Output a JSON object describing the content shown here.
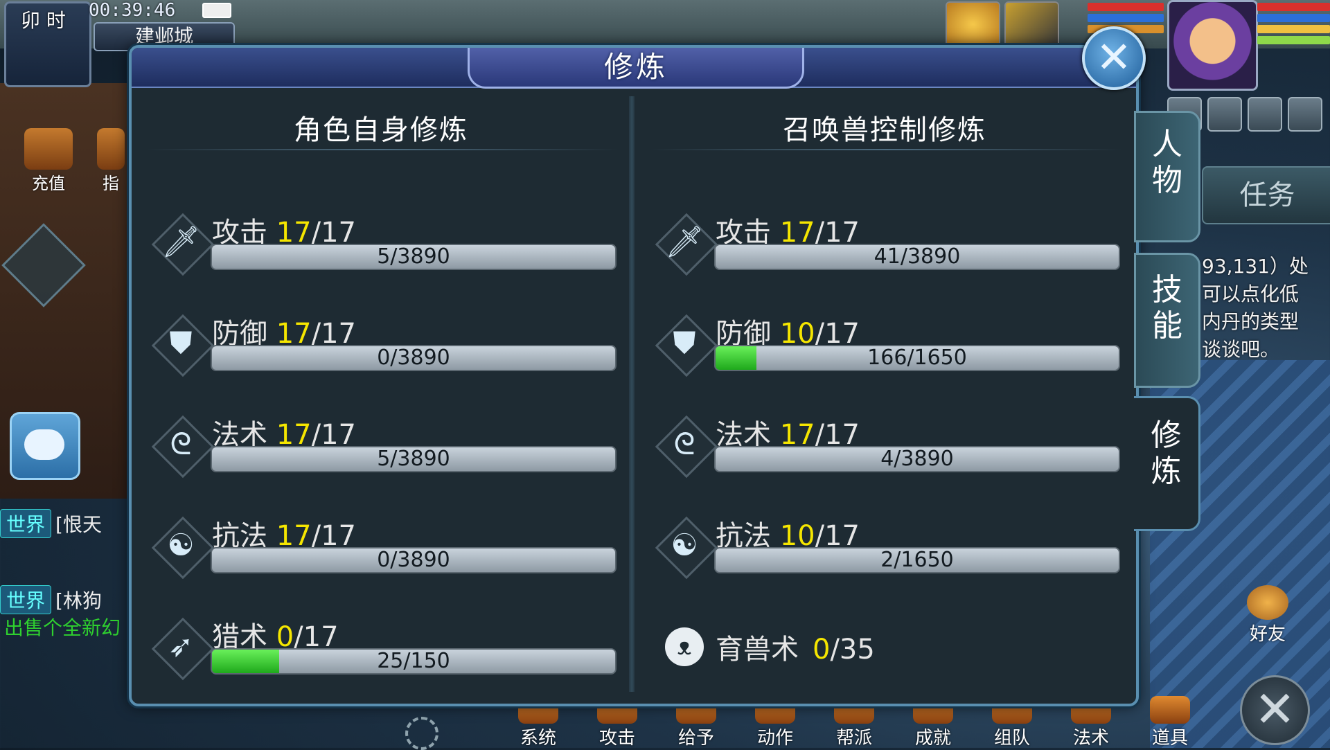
{
  "hud": {
    "shichen": "卯 时",
    "time": "00:39:46",
    "city": "建邺城",
    "recharge_label": "充值",
    "guide_label": "指",
    "chat_messages": [
      {
        "channel": "世界",
        "text": "[恨天",
        "sub": ""
      },
      {
        "channel": "世界",
        "text": "[林狗",
        "sub": "出售个全新幻"
      }
    ]
  },
  "right_hud": {
    "task_tab": "任务",
    "task_text": [
      "93,131）处",
      "可以点化低",
      "内丹的类型",
      "谈谈吧。"
    ],
    "friend_label": "好友",
    "close_icon_label": "✕"
  },
  "bottom_bar": [
    "系统",
    "攻击",
    "给予",
    "动作",
    "帮派",
    "成就",
    "组队",
    "法术",
    "道具"
  ],
  "dialog": {
    "title": "修炼",
    "close": "✕",
    "left_title": "角色自身修炼",
    "right_title": "召唤兽控制修炼",
    "left_rows": [
      {
        "name": "攻击",
        "level": "17",
        "max": "/17",
        "progress": "5/3890",
        "fraction": 0.0013,
        "icon": "sword-icon",
        "glyph": "🗡"
      },
      {
        "name": "防御",
        "level": "17",
        "max": "/17",
        "progress": "0/3890",
        "fraction": 0.0,
        "icon": "shield-icon",
        "glyph": "⛊"
      },
      {
        "name": "法术",
        "level": "17",
        "max": "/17",
        "progress": "5/3890",
        "fraction": 0.0013,
        "icon": "staff-icon",
        "glyph": "ᘓ"
      },
      {
        "name": "抗法",
        "level": "17",
        "max": "/17",
        "progress": "0/3890",
        "fraction": 0.0,
        "icon": "yinyang-icon",
        "glyph": "☯"
      },
      {
        "name": "猎术",
        "level": "0",
        "max": "/17",
        "progress": "25/150",
        "fraction": 0.1667,
        "icon": "bow-icon",
        "glyph": "➶"
      }
    ],
    "right_rows": [
      {
        "name": "攻击",
        "level": "17",
        "max": "/17",
        "progress": "41/3890",
        "fraction": 0.0105,
        "icon": "sword-icon",
        "glyph": "🗡"
      },
      {
        "name": "防御",
        "level": "10",
        "max": "/17",
        "progress": "166/1650",
        "fraction": 0.1006,
        "icon": "shield-icon",
        "glyph": "⛊"
      },
      {
        "name": "法术",
        "level": "17",
        "max": "/17",
        "progress": "4/3890",
        "fraction": 0.001,
        "icon": "staff-icon",
        "glyph": "ᘓ"
      },
      {
        "name": "抗法",
        "level": "10",
        "max": "/17",
        "progress": "2/1650",
        "fraction": 0.0012,
        "icon": "yinyang-icon",
        "glyph": "☯"
      }
    ],
    "pet_row": {
      "name": "育兽术",
      "level": "0",
      "max": "/35",
      "icon": "panda-icon",
      "glyph": "ᴥ"
    }
  },
  "side_tabs": [
    {
      "label": "人物",
      "active": false
    },
    {
      "label": "技能",
      "active": false
    },
    {
      "label": "修炼",
      "active": true
    }
  ],
  "colors": {
    "level_yellow": "#f5e600",
    "bar_green": "#1fa91c",
    "dialog_border": "#5a8fb0",
    "title_blue": "#3a4f8d"
  }
}
